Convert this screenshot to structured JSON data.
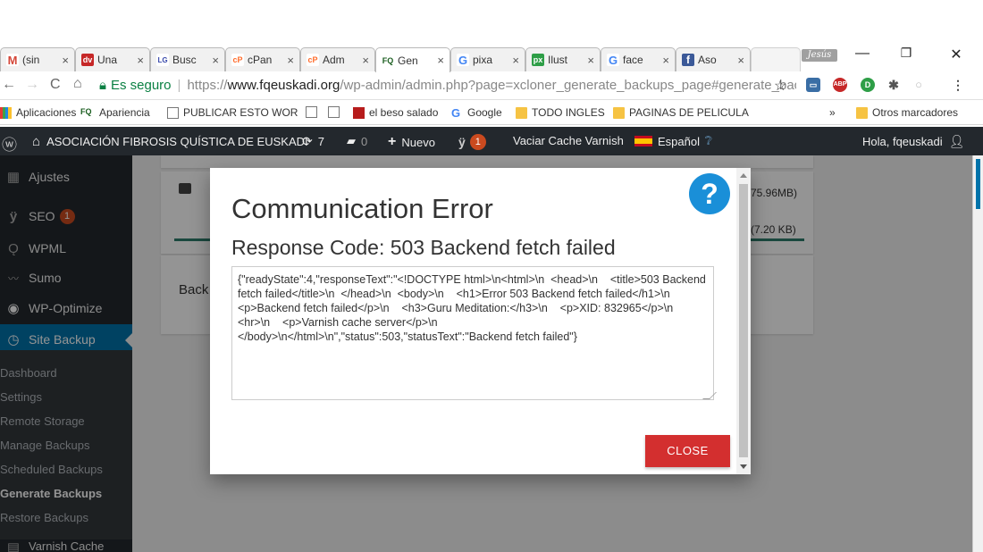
{
  "browser": {
    "tabs": [
      {
        "title": "(sin",
        "icon": "gmail-icon",
        "color": "#d44638",
        "glyph": "M"
      },
      {
        "title": "Una",
        "icon": "dv-icon",
        "color": "#c62828",
        "glyph": "dv"
      },
      {
        "title": "Busc",
        "icon": "lg-icon",
        "color": "#3949ab",
        "glyph": "LG"
      },
      {
        "title": "cPan",
        "icon": "cpanel-icon",
        "color": "#ff6c2c",
        "glyph": "cP"
      },
      {
        "title": "Adm",
        "icon": "cpanel-icon",
        "color": "#ff6c2c",
        "glyph": "cP"
      },
      {
        "title": "Gen",
        "icon": "fq-icon",
        "color": "#1b5e20",
        "glyph": "FQ"
      },
      {
        "title": "pixa",
        "icon": "google-icon",
        "color": "#4285f4",
        "glyph": "G"
      },
      {
        "title": "Ilust",
        "icon": "px-icon",
        "color": "#2e9e47",
        "glyph": "px"
      },
      {
        "title": "face",
        "icon": "google-icon",
        "color": "#4285f4",
        "glyph": "G"
      },
      {
        "title": "Aso",
        "icon": "facebook-icon",
        "color": "#3b5998",
        "glyph": "f"
      }
    ],
    "profile": "Jesús",
    "window_controls": {
      "minimize": "—",
      "maximize": "❐",
      "close": "✕"
    },
    "address": {
      "secure_label": "Es seguro",
      "scheme": "https://",
      "domain": "www.fqeuskadi.org",
      "path": "/wp-admin/admin.php?page=xcloner_generate_backups_page#generate_bacl"
    },
    "bookmarks": [
      {
        "label": "Aplicaciones",
        "icon": "apps-icon"
      },
      {
        "label": "Apariencia",
        "icon": "fq-icon"
      },
      {
        "label": "PUBLICAR ESTO WOR",
        "icon": "page-icon"
      },
      {
        "label": "",
        "icon": "page-icon"
      },
      {
        "label": "",
        "icon": "page-icon"
      },
      {
        "label": "el beso salado",
        "icon": "red-square-icon"
      },
      {
        "label": "Google",
        "icon": "google-icon"
      },
      {
        "label": "TODO INGLES",
        "icon": "folder-icon"
      },
      {
        "label": "PAGINAS DE PELICULA",
        "icon": "folder-icon"
      }
    ],
    "bookmarks_overflow": "»",
    "other_bookmarks": "Otros marcadores"
  },
  "adminbar": {
    "site_name": "ASOCIACIÓN FIBROSIS QUÍSTICA DE EUSKADI",
    "updates": "7",
    "comments": "0",
    "new_label": "Nuevo",
    "yoast_count": "1",
    "varnish_label": "Vaciar Cache Varnish",
    "language": "Español",
    "greeting": "Hola, fqeuskadi"
  },
  "sidebar": {
    "items": [
      {
        "label": "Ajustes",
        "icon": "settings-icon"
      },
      {
        "label": "SEO",
        "icon": "yoast-icon",
        "badge": "1"
      },
      {
        "label": "WPML",
        "icon": "wpml-icon"
      },
      {
        "label": "Sumo",
        "icon": "sumo-icon"
      },
      {
        "label": "WP-Optimize",
        "icon": "optimize-icon"
      },
      {
        "label": "Site Backup",
        "icon": "backup-icon"
      }
    ],
    "submenu": [
      {
        "label": "Dashboard"
      },
      {
        "label": "Settings"
      },
      {
        "label": "Remote Storage"
      },
      {
        "label": "Manage Backups"
      },
      {
        "label": "Scheduled Backups"
      },
      {
        "label": "Generate Backups"
      },
      {
        "label": "Restore Backups"
      }
    ],
    "cut_item": "Varnish Cache"
  },
  "content": {
    "size_total": "75.96MB)",
    "size_small": "(7.20 KB)",
    "back_label": "Back"
  },
  "modal": {
    "title": "Communication Error",
    "subtitle": "Response Code: 503 Backend fetch failed",
    "response_text": "{\"readyState\":4,\"responseText\":\"<!DOCTYPE html>\\n<html>\\n  <head>\\n    <title>503 Backend fetch failed</title>\\n  </head>\\n  <body>\\n    <h1>Error 503 Backend fetch failed</h1>\\n    <p>Backend fetch failed</p>\\n    <h3>Guru Meditation:</h3>\\n    <p>XID: 832965</p>\\n    <hr>\\n    <p>Varnish cache server</p>\\n  </body>\\n</html>\\n\",\"status\":503,\"statusText\":\"Backend fetch failed\"}",
    "close_label": "CLOSE",
    "help_glyph": "?"
  }
}
